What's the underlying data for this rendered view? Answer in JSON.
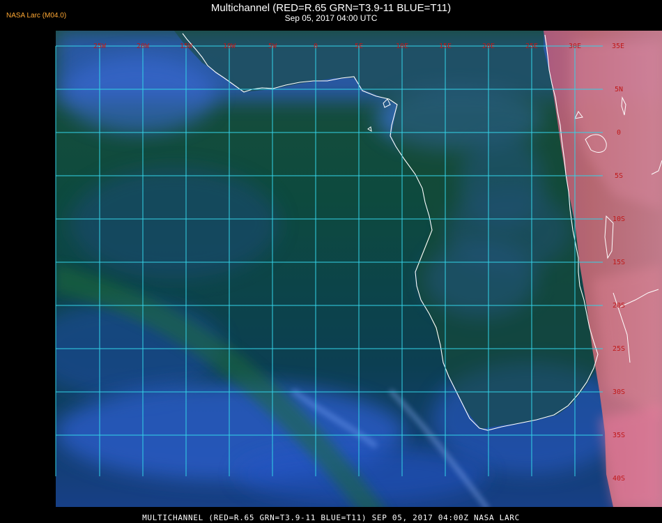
{
  "header": {
    "title": "Multichannel (RED=R.65 GRN=T3.9-11 BLUE=T11)",
    "date": "Sep 05, 2017 04:00 UTC",
    "corner_label": "NASA Larc (M04.0)"
  },
  "footer": {
    "text": "MULTICHANNEL (RED=R.65 GRN=T3.9-11 BLUE=T11) SEP 05, 2017 04:00Z   NASA LARC"
  },
  "map": {
    "region": "Southern Africa / South Atlantic",
    "longitude_labels": [
      "25W",
      "20W",
      "15W",
      "10W",
      "5W",
      "0",
      "5E",
      "10E",
      "15E",
      "20E",
      "25E",
      "30E",
      "35E"
    ],
    "latitude_labels": [
      "5N",
      "0",
      "5S",
      "10S",
      "15S",
      "20S",
      "25S",
      "30S",
      "35S",
      "40S"
    ],
    "colors": {
      "grid": "#33d4e8",
      "coastline": "#ffffff",
      "grid_label": "#c01818",
      "corner_label": "#ffa833",
      "ocean_dark": "#0a3d3a",
      "cloud_blue": "#2d5fd8",
      "land_pink": "#d86a8a"
    }
  }
}
